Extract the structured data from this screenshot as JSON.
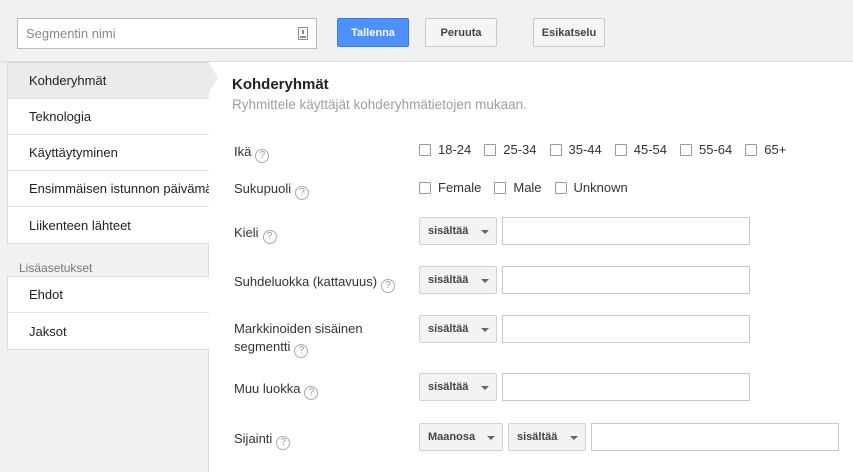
{
  "toolbar": {
    "segment_name_placeholder": "Segmentin nimi",
    "save_label": "Tallenna",
    "cancel_label": "Peruuta",
    "preview_label": "Esikatselu"
  },
  "sidebar": {
    "items": [
      {
        "label": "Kohderyhmät",
        "active": true
      },
      {
        "label": "Teknologia"
      },
      {
        "label": "Käyttäytyminen"
      },
      {
        "label": "Ensimmäisen istunnon päivämäärä"
      },
      {
        "label": "Liikenteen lähteet"
      }
    ],
    "section_label": "Lisäasetukset",
    "advanced_items": [
      {
        "label": "Ehdot"
      },
      {
        "label": "Jaksot"
      }
    ]
  },
  "main": {
    "title": "Kohderyhmät",
    "subtitle": "Ryhmittele käyttäjät kohderyhmätietojen mukaan.",
    "help_glyph": "?",
    "age": {
      "label": "Ikä",
      "options": [
        "18-24",
        "25-34",
        "35-44",
        "45-54",
        "55-64",
        "65+"
      ]
    },
    "gender": {
      "label": "Sukupuoli",
      "options": [
        "Female",
        "Male",
        "Unknown"
      ]
    },
    "language": {
      "label": "Kieli",
      "operator": "sisältää",
      "value": ""
    },
    "affinity": {
      "label": "Suhdeluokka (kattavuus)",
      "operator": "sisältää",
      "value": ""
    },
    "in_market": {
      "label_line1": "Markkinoiden sisäinen",
      "label_line2": "segmentti",
      "operator": "sisältää",
      "value": ""
    },
    "other": {
      "label": "Muu luokka",
      "operator": "sisältää",
      "value": ""
    },
    "location": {
      "label": "Sijainti",
      "scope": "Maanosa",
      "operator": "sisältää",
      "value": ""
    }
  }
}
